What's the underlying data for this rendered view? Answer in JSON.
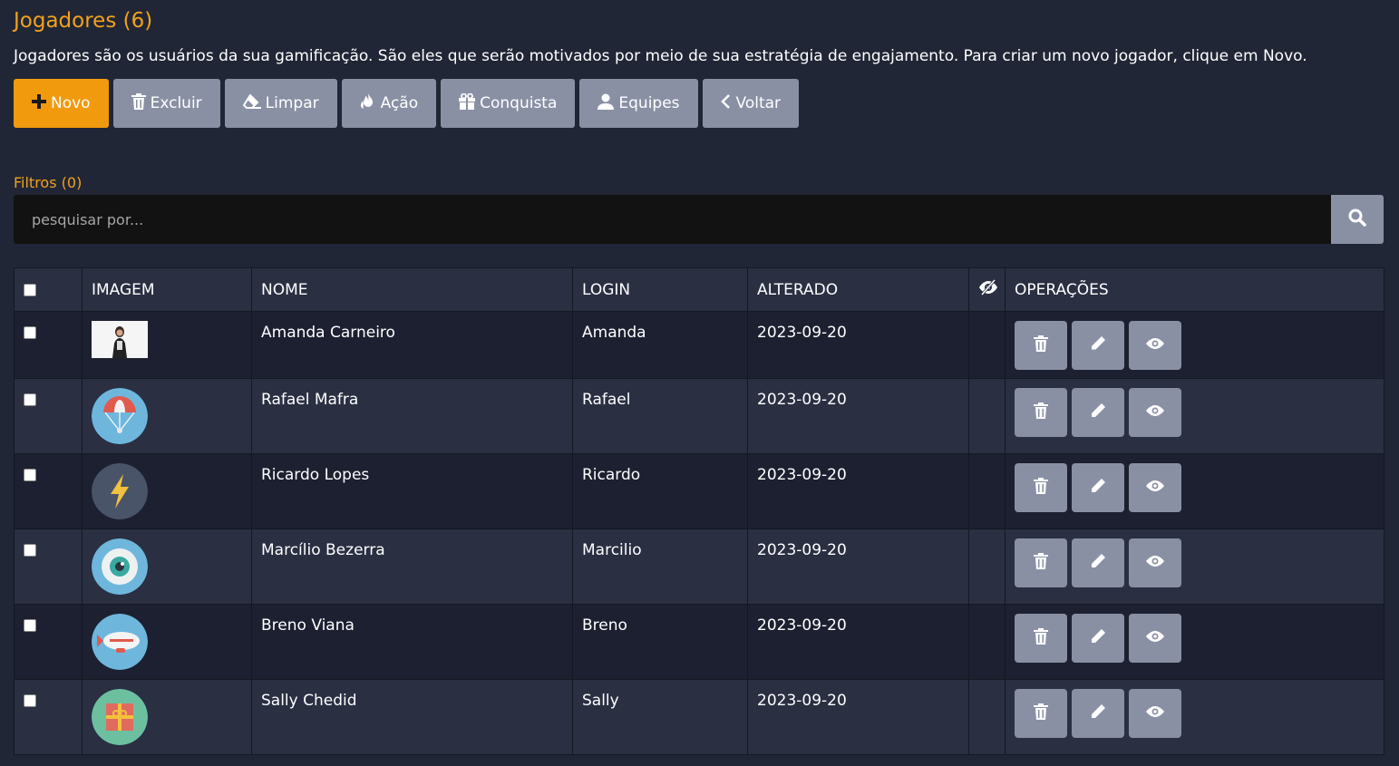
{
  "header": {
    "title": "Jogadores (6)",
    "description": "Jogadores são os usuários da sua gamificação. São eles que serão motivados por meio de sua estratégia de engajamento. Para criar um novo jogador, clique em Novo."
  },
  "toolbar": {
    "novo": "Novo",
    "excluir": "Excluir",
    "limpar": "Limpar",
    "acao": "Ação",
    "conquista": "Conquista",
    "equipes": "Equipes",
    "voltar": "Voltar"
  },
  "filters": {
    "label": "Filtros (0)",
    "placeholder": "pesquisar por..."
  },
  "table": {
    "headers": {
      "imagem": "IMAGEM",
      "nome": "NOME",
      "login": "LOGIN",
      "alterado": "ALTERADO",
      "operacoes": "OPERAÇÕES"
    },
    "rows": [
      {
        "nome": "Amanda Carneiro",
        "login": "Amanda",
        "alterado": "2023-09-20",
        "image": "photo"
      },
      {
        "nome": "Rafael Mafra",
        "login": "Rafael",
        "alterado": "2023-09-20",
        "image": "parachute-icon"
      },
      {
        "nome": "Ricardo Lopes",
        "login": "Ricardo",
        "alterado": "2023-09-20",
        "image": "lightning-icon"
      },
      {
        "nome": "Marcílio Bezerra",
        "login": "Marcilio",
        "alterado": "2023-09-20",
        "image": "eye-icon"
      },
      {
        "nome": "Breno Viana",
        "login": "Breno",
        "alterado": "2023-09-20",
        "image": "blimp-icon"
      },
      {
        "nome": "Sally Chedid",
        "login": "Sally",
        "alterado": "2023-09-20",
        "image": "gift-icon"
      }
    ]
  },
  "colors": {
    "background": "#212636",
    "accent": "#f29a0d",
    "button": "#8a90a4",
    "row_dark": "#1c2030",
    "row_light": "#2a2f42"
  }
}
